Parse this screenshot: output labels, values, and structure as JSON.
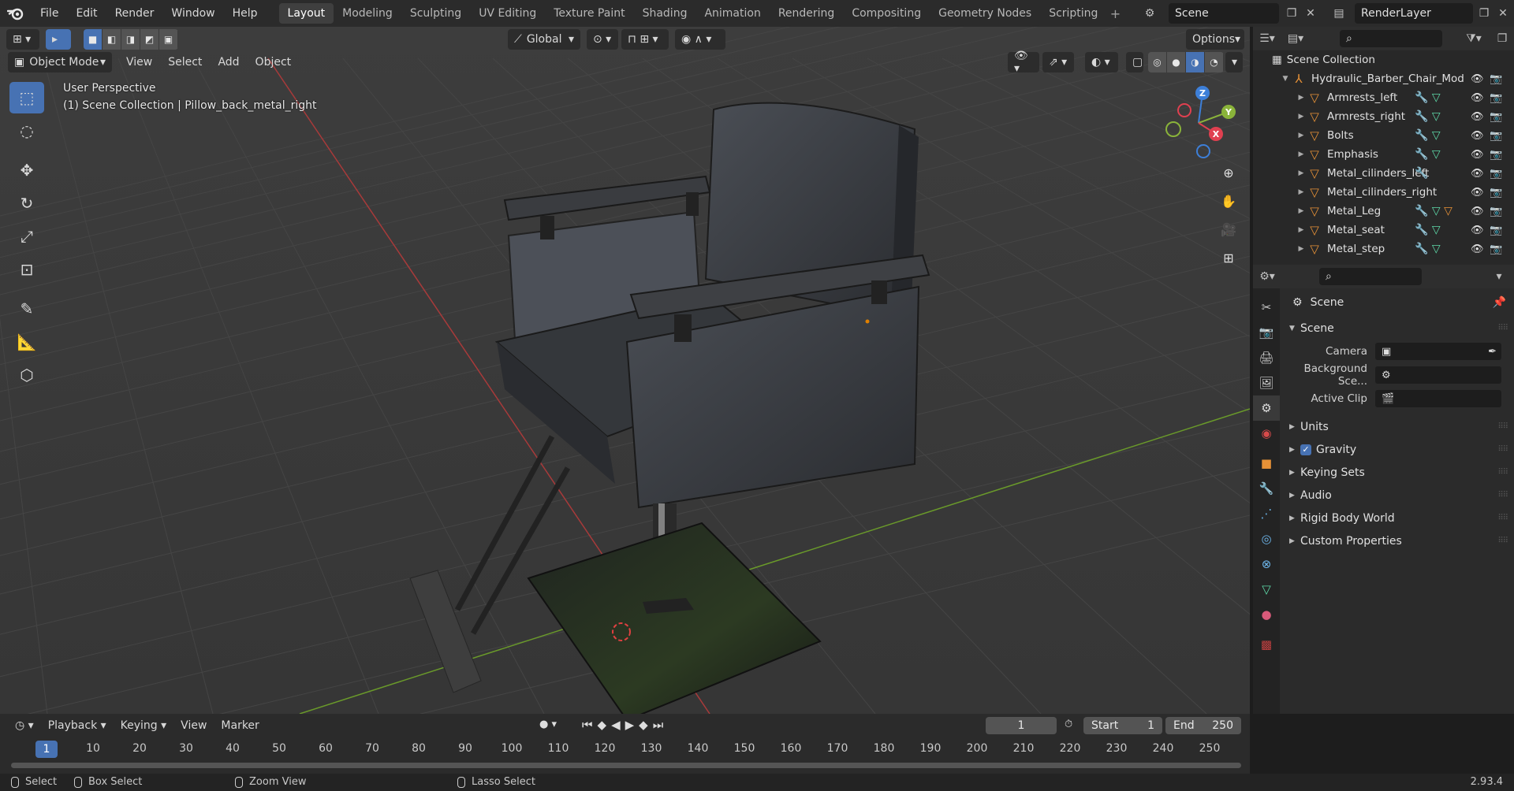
{
  "topbar": {
    "menus": [
      "File",
      "Edit",
      "Render",
      "Window",
      "Help"
    ],
    "workspaces": [
      "Layout",
      "Modeling",
      "Sculpting",
      "UV Editing",
      "Texture Paint",
      "Shading",
      "Animation",
      "Rendering",
      "Compositing",
      "Geometry Nodes",
      "Scripting"
    ],
    "active_workspace": "Layout",
    "add_workspace": "+",
    "scene_name": "Scene",
    "view_layer": "RenderLayer"
  },
  "viewport": {
    "orientation": "Global",
    "options_label": "Options",
    "mode": "Object Mode",
    "menus": [
      "View",
      "Select",
      "Add",
      "Object"
    ],
    "overlay_line1": "User Perspective",
    "overlay_line2": "(1) Scene Collection | Pillow_back_metal_right",
    "gizmo": {
      "x": "X",
      "y": "Y",
      "z": "Z"
    }
  },
  "outliner": {
    "root": "Scene Collection",
    "collection": "Hydraulic_Barber_Chair_Mod",
    "items": [
      {
        "name": "Armrests_left",
        "mods": "wrench+mesh"
      },
      {
        "name": "Armrests_right",
        "mods": "wrench+mesh"
      },
      {
        "name": "Bolts",
        "mods": "wrench+mesh"
      },
      {
        "name": "Emphasis",
        "mods": "wrench+mesh"
      },
      {
        "name": "Metal_cilinders_left",
        "mods": "wrench"
      },
      {
        "name": "Metal_cilinders_right",
        "mods": "none"
      },
      {
        "name": "Metal_Leg",
        "mods": "wrench+mesh+obj"
      },
      {
        "name": "Metal_seat",
        "mods": "wrench+mesh"
      },
      {
        "name": "Metal_step",
        "mods": "wrench+mesh"
      }
    ]
  },
  "properties": {
    "context": "Scene",
    "panel_scene": "Scene",
    "camera_label": "Camera",
    "background_label": "Background Sce...",
    "active_clip_label": "Active Clip",
    "panels": [
      "Units",
      "Gravity",
      "Keying Sets",
      "Audio",
      "Rigid Body World",
      "Custom Properties"
    ],
    "gravity_checked": true
  },
  "timeline": {
    "menus": [
      "Playback",
      "Keying",
      "View",
      "Marker"
    ],
    "current_frame": "1",
    "start_label": "Start",
    "start_value": "1",
    "end_label": "End",
    "end_value": "250",
    "ticks": [
      "10",
      "20",
      "30",
      "40",
      "50",
      "60",
      "70",
      "80",
      "90",
      "100",
      "110",
      "120",
      "130",
      "140",
      "150",
      "160",
      "170",
      "180",
      "190",
      "200",
      "210",
      "220",
      "230",
      "240",
      "250"
    ]
  },
  "statusbar": {
    "select": "Select",
    "box_select": "Box Select",
    "zoom_view": "Zoom View",
    "lasso_select": "Lasso Select",
    "version": "2.93.4"
  }
}
